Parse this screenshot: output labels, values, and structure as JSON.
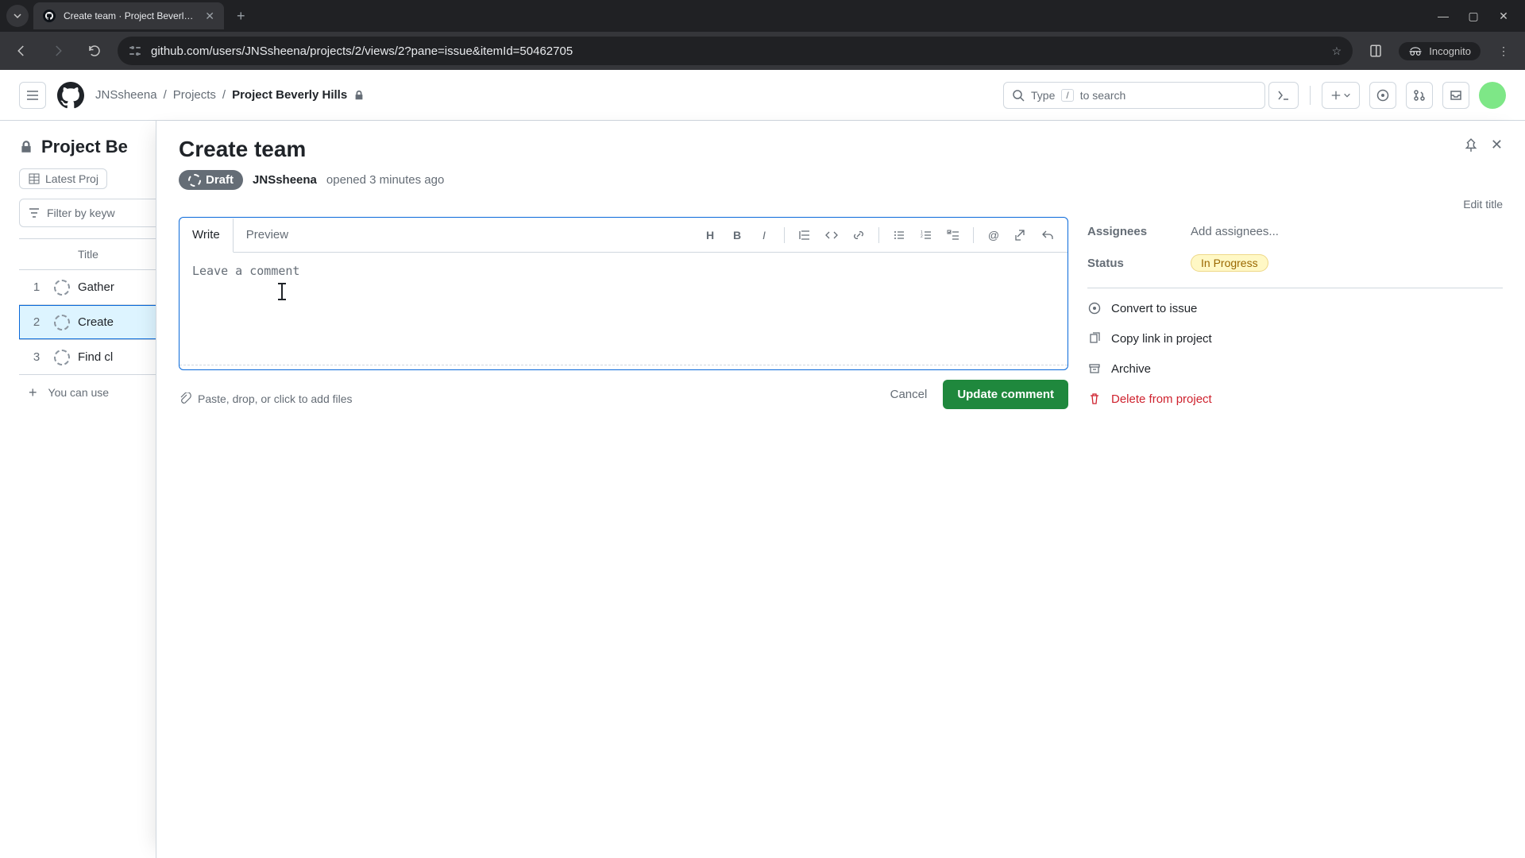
{
  "browser": {
    "tab_title": "Create team · Project Beverly H",
    "url": "github.com/users/JNSsheena/projects/2/views/2?pane=issue&itemId=50462705",
    "incognito_label": "Incognito"
  },
  "gh_header": {
    "crumbs": {
      "user": "JNSsheena",
      "section": "Projects",
      "project": "Project Beverly Hills"
    },
    "search_prompt_before": "Type ",
    "search_key": "/",
    "search_prompt_after": " to search"
  },
  "project_bg": {
    "title": "Project Be",
    "tab_label": "Latest Proj",
    "filter_placeholder": "Filter by keyw",
    "title_col": "Title",
    "rows": [
      {
        "num": "1",
        "title": "Gather"
      },
      {
        "num": "2",
        "title": "Create"
      },
      {
        "num": "3",
        "title": "Find cl"
      }
    ],
    "add_hint": "You can use"
  },
  "panel": {
    "title": "Create team",
    "draft_label": "Draft",
    "author": "JNSsheena",
    "opened": "opened 3 minutes ago",
    "edit_title": "Edit title",
    "tabs": {
      "write": "Write",
      "preview": "Preview"
    },
    "comment_placeholder": "Leave a comment",
    "attach_hint": "Paste, drop, or click to add files",
    "cancel": "Cancel",
    "submit": "Update comment"
  },
  "sidebar": {
    "assignees_label": "Assignees",
    "assignees_value": "Add assignees...",
    "status_label": "Status",
    "status_value": "In Progress",
    "actions": {
      "convert": "Convert to issue",
      "copylink": "Copy link in project",
      "archive": "Archive",
      "delete": "Delete from project"
    }
  }
}
